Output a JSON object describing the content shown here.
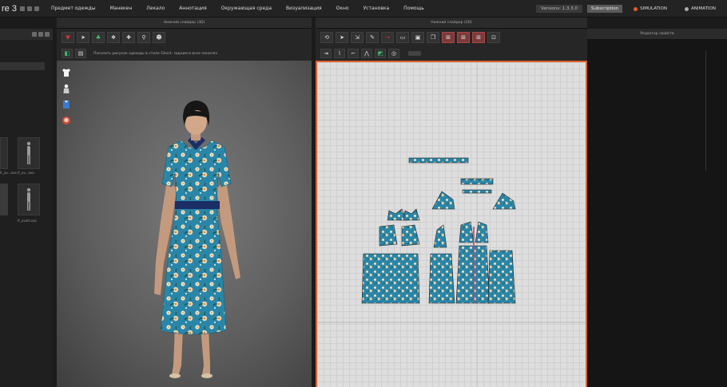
{
  "app": {
    "logo": "re 3"
  },
  "menu": [
    "Предмет одежды",
    "Манекен",
    "Лекало",
    "Аннотация",
    "Окружающая среда",
    "Визуализация",
    "Окно",
    "Установка",
    "Помощь"
  ],
  "top_right": {
    "version_label": "Versions: 1.3.3.0",
    "status": "Subscription",
    "button_simulation": "SIMULATION",
    "button_animation": "ANIMATION"
  },
  "panels": {
    "left_title": "",
    "viewport3d_title": "Нижний слайдер (3D)",
    "viewport2d_title": "Нижний слайдер (2D)",
    "right_title": "Редактор свойств"
  },
  "toolbar_hint": "Показать рисунок одежды в стиле Ghost: задним в всех панелях",
  "thumbnails": [
    {
      "label": "fr_av...ava"
    },
    {
      "label": "fr_av...ava"
    },
    {
      "label": "fr_avatl.ava"
    }
  ],
  "colors": {
    "accent": "#e06030",
    "fabric": "#2a86a8",
    "viewport_bg": "#6b6b6b",
    "pattern_bg": "#dedede"
  },
  "icons": [
    "shirt-icon",
    "avatar-icon",
    "clothes-icon",
    "head-icon",
    "undo-icon",
    "garment-icon"
  ]
}
